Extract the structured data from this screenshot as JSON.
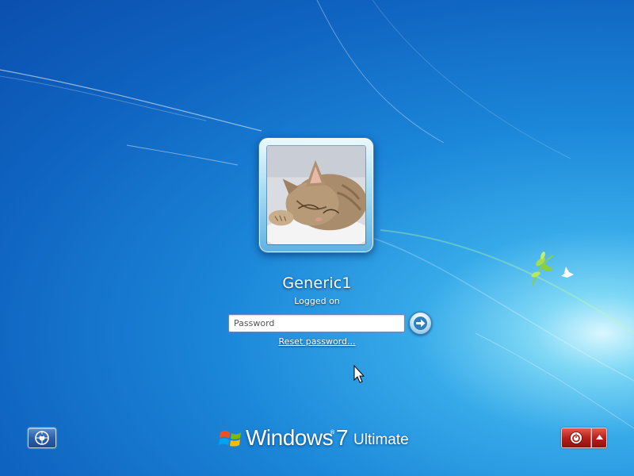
{
  "user": {
    "name": "Generic1",
    "status": "Logged on"
  },
  "password": {
    "placeholder": "Password",
    "value": ""
  },
  "links": {
    "reset_password": "Reset password..."
  },
  "branding": {
    "product": "Windows",
    "trademark": "®",
    "version": "7",
    "edition": "Ultimate"
  },
  "icons": {
    "submit": "arrow-right-icon",
    "ease_of_access": "ease-of-access-icon",
    "shutdown": "power-icon",
    "shutdown_options": "chevron-up-icon"
  },
  "colors": {
    "background": "#1b86d8",
    "shutdown": "#b9201a"
  }
}
